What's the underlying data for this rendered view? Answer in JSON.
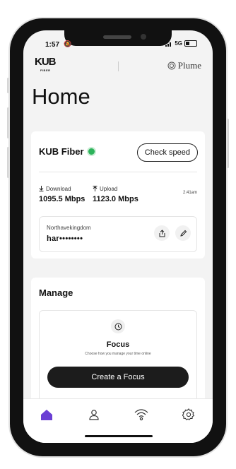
{
  "status_bar": {
    "time": "1:57",
    "network": "5G"
  },
  "header": {
    "brand_logo": "KUB",
    "brand_logo_sub": "FIBER",
    "partner_logo": "Plume"
  },
  "page": {
    "title": "Home"
  },
  "connection_card": {
    "isp_name": "KUB Fiber",
    "status_color": "#2db35b",
    "check_speed_label": "Check speed",
    "download_label": "Download",
    "download_value": "1095.5 Mbps",
    "upload_label": "Upload",
    "upload_value": "1123.0 Mbps",
    "timestamp": "2:41am",
    "network_name": "Northavekingdom",
    "network_password": "har••••••••"
  },
  "manage_card": {
    "title": "Manage",
    "focus_title": "Focus",
    "focus_description": "Choose how you manage your time online",
    "create_focus_label": "Create a Focus"
  },
  "tab_bar": {
    "accent_color": "#6b3fd4",
    "tabs": [
      {
        "icon": "home-icon",
        "active": true
      },
      {
        "icon": "person-icon",
        "active": false
      },
      {
        "icon": "wifi-icon",
        "active": false
      },
      {
        "icon": "gear-icon",
        "active": false
      }
    ]
  }
}
